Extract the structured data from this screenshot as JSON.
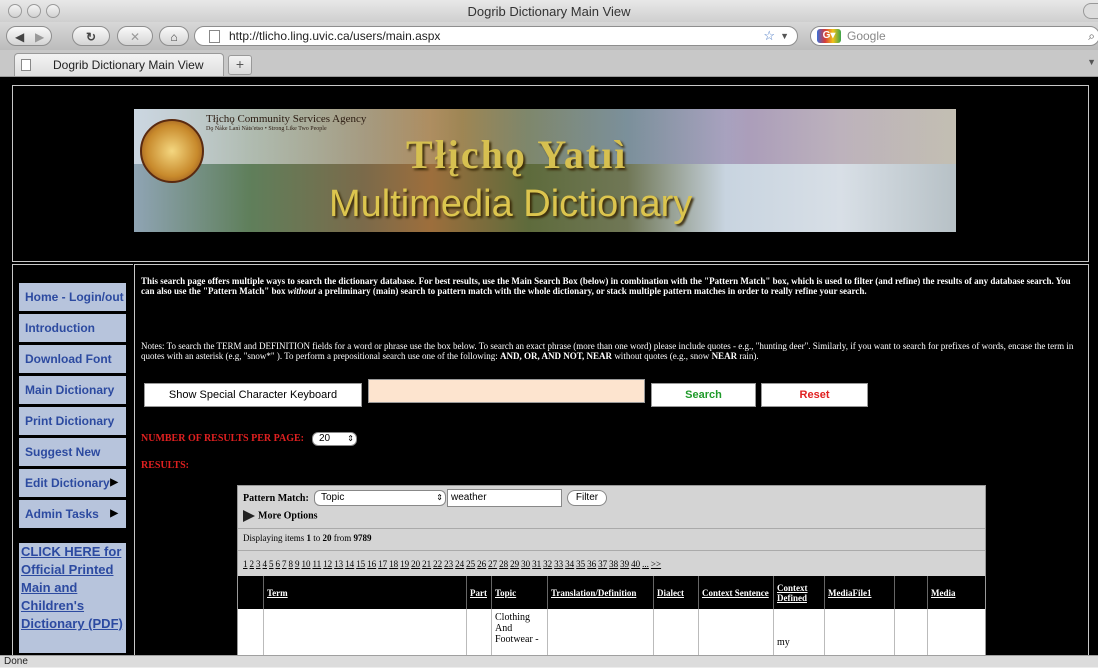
{
  "window": {
    "title": "Dogrib Dictionary Main View"
  },
  "toolbar": {
    "url": "http://tlicho.ling.uvic.ca/users/main.aspx",
    "search_placeholder": "Google",
    "back_icon": "back-arrow",
    "forward_icon": "forward-arrow",
    "reload_icon": "reload",
    "stop_icon": "stop",
    "home_icon": "home"
  },
  "tabs": [
    {
      "label": "Dogrib Dictionary Main View"
    }
  ],
  "new_tab_label": "+",
  "banner": {
    "agency": "Tłįchǫ Community Services Agency",
    "motto": "Dǫ Nàke Lanì Nàts'etso • Strong Like Two People",
    "title": "Tłįchǫ Yatıì",
    "subtitle": "Multimedia Dictionary"
  },
  "nav": {
    "items": [
      {
        "label": "Home - Login/out",
        "has_submenu": false
      },
      {
        "label": "Introduction",
        "has_submenu": false
      },
      {
        "label": "Download Font",
        "has_submenu": false
      },
      {
        "label": "Main Dictionary",
        "has_submenu": false
      },
      {
        "label": "Print Dictionary",
        "has_submenu": false
      },
      {
        "label": "Suggest New",
        "has_submenu": false
      },
      {
        "label": "Edit Dictionary",
        "has_submenu": true
      },
      {
        "label": "Admin Tasks",
        "has_submenu": true
      }
    ],
    "submenu_arrow": "▶",
    "cta": "CLICK HERE for Official Printed Main and Children's Dictionary (PDF)"
  },
  "main": {
    "intro_a": "This search page offers multiple ways to search the dictionary database. For best results, use the Main Search Box (below) in combination with the \"Pattern Match\" box, which is used to filter (and refine) the results of any database search. You can also use the \"Pattern Match\" box ",
    "intro_em": "without",
    "intro_b": " a preliminary (main) search to pattern match with the whole dictionary, or stack multiple pattern matches in order to really refine your search.",
    "notes_a": "Notes: To search the TERM and DEFINITION fields for a word or phrase use the box below. To search an exact phrase (more than one word) please include quotes - e.g., \"hunting deer\". Similarly, if you want to search for prefixes of words, encase the term in quotes with an asterisk (e.g, \"snow*\" ). To perform a prepositional search use one of the following: ",
    "notes_ops": "AND, OR, AND NOT, NEAR",
    "notes_b": " without quotes (e.g., snow ",
    "notes_near": "NEAR",
    "notes_c": " rain).",
    "special_keyboard_label": "Show Special Character Keyboard",
    "search_value": "",
    "search_label": "Search",
    "reset_label": "Reset",
    "results_per_page_label": "NUMBER OF RESULTS PER PAGE:",
    "results_per_page_value": "20",
    "results_label": "RESULTS:",
    "colors": {
      "search_green": "#1f9a2a",
      "reset_red": "#e02020",
      "label_red": "#e02020"
    }
  },
  "grid": {
    "pattern_label": "Pattern Match:",
    "pattern_field": "Topic",
    "pattern_value": "weather",
    "filter_label": "Filter",
    "more_options_label": "More Options",
    "display_prefix": "Displaying items ",
    "display_from": "1",
    "display_to_word": " to ",
    "display_to": "20",
    "display_from_word": " from ",
    "display_total": "9789",
    "pages": [
      "1",
      "2",
      "3",
      "4",
      "5",
      "6",
      "7",
      "8",
      "9",
      "10",
      "11",
      "12",
      "13",
      "14",
      "15",
      "16",
      "17",
      "18",
      "19",
      "20",
      "21",
      "22",
      "23",
      "24",
      "25",
      "26",
      "27",
      "28",
      "29",
      "30",
      "31",
      "32",
      "33",
      "34",
      "35",
      "36",
      "37",
      "38",
      "39",
      "40",
      "...",
      ">>"
    ],
    "columns": [
      "",
      "Term",
      "Part",
      "Topic",
      "Translation/Definition",
      "Dialect",
      "Context Sentence",
      "Context Defined",
      "MediaFile1",
      "",
      "Media"
    ],
    "rows": [
      {
        "topic": "Clothing And Footwear -",
        "context_defined": "my"
      }
    ]
  },
  "status": {
    "text": "Done"
  }
}
